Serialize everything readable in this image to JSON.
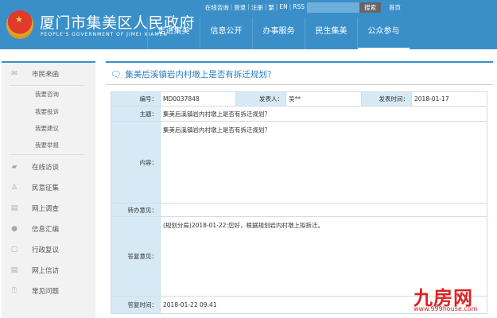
{
  "header": {
    "site_title": "厦门市集美区人民政府",
    "site_subtitle": "PEOPLE'S GOVERNMENT OF JIMEI XIAMEN",
    "top_links": [
      "在线咨询",
      "登录",
      "注册",
      "繁",
      "EN",
      "RSS"
    ],
    "search_button": "搜索",
    "search_value": "",
    "home": "首页",
    "nav": [
      "走进集美",
      "信息公开",
      "办事服务",
      "民生集美",
      "公众参与"
    ],
    "active_nav": "公众参与"
  },
  "sidebar": {
    "section": "市民来函",
    "sub_items": [
      "我要咨询",
      "我要投诉",
      "我要建议",
      "我要举报"
    ],
    "items": [
      {
        "label": "在线访谈",
        "icon": "chat-icon"
      },
      {
        "label": "民意征集",
        "icon": "person-icon"
      },
      {
        "label": "网上调查",
        "icon": "document-icon"
      },
      {
        "label": "信息汇编",
        "icon": "globe-icon"
      },
      {
        "label": "行政复议",
        "icon": "file-icon"
      },
      {
        "label": "网上信访",
        "icon": "document-icon"
      },
      {
        "label": "常见问题",
        "icon": "question-icon"
      }
    ]
  },
  "main": {
    "title": "集美后溪镇岩内村墩上是否有拆迁规划？",
    "labels": {
      "number": "编号：",
      "author": "发表人：",
      "time": "发表时间：",
      "subject": "主题：",
      "content": "内容：",
      "forward": "转办意见：",
      "reply": "答复意见：",
      "reply_time": "答复时间："
    },
    "values": {
      "number": "MD0037848",
      "author": "吴**",
      "time": "2018-01-17",
      "subject": "集美后溪镇岩内村墩上是否有拆迁规划？",
      "content": "集美后溪镇岩内村墩上是否有拆迁规划？",
      "forward": "",
      "reply": "(规划分局)2018-01-22:您好，根据规划岩内村墩上拟拆迁。",
      "reply_time": "2018-01-22 09:41"
    }
  },
  "watermark": {
    "logo": "九房网",
    "url": "www.999house.com"
  },
  "colors": {
    "brand": "#3a8fc9",
    "label_bg": "#d8e9f6",
    "title": "#2a7dc0"
  }
}
